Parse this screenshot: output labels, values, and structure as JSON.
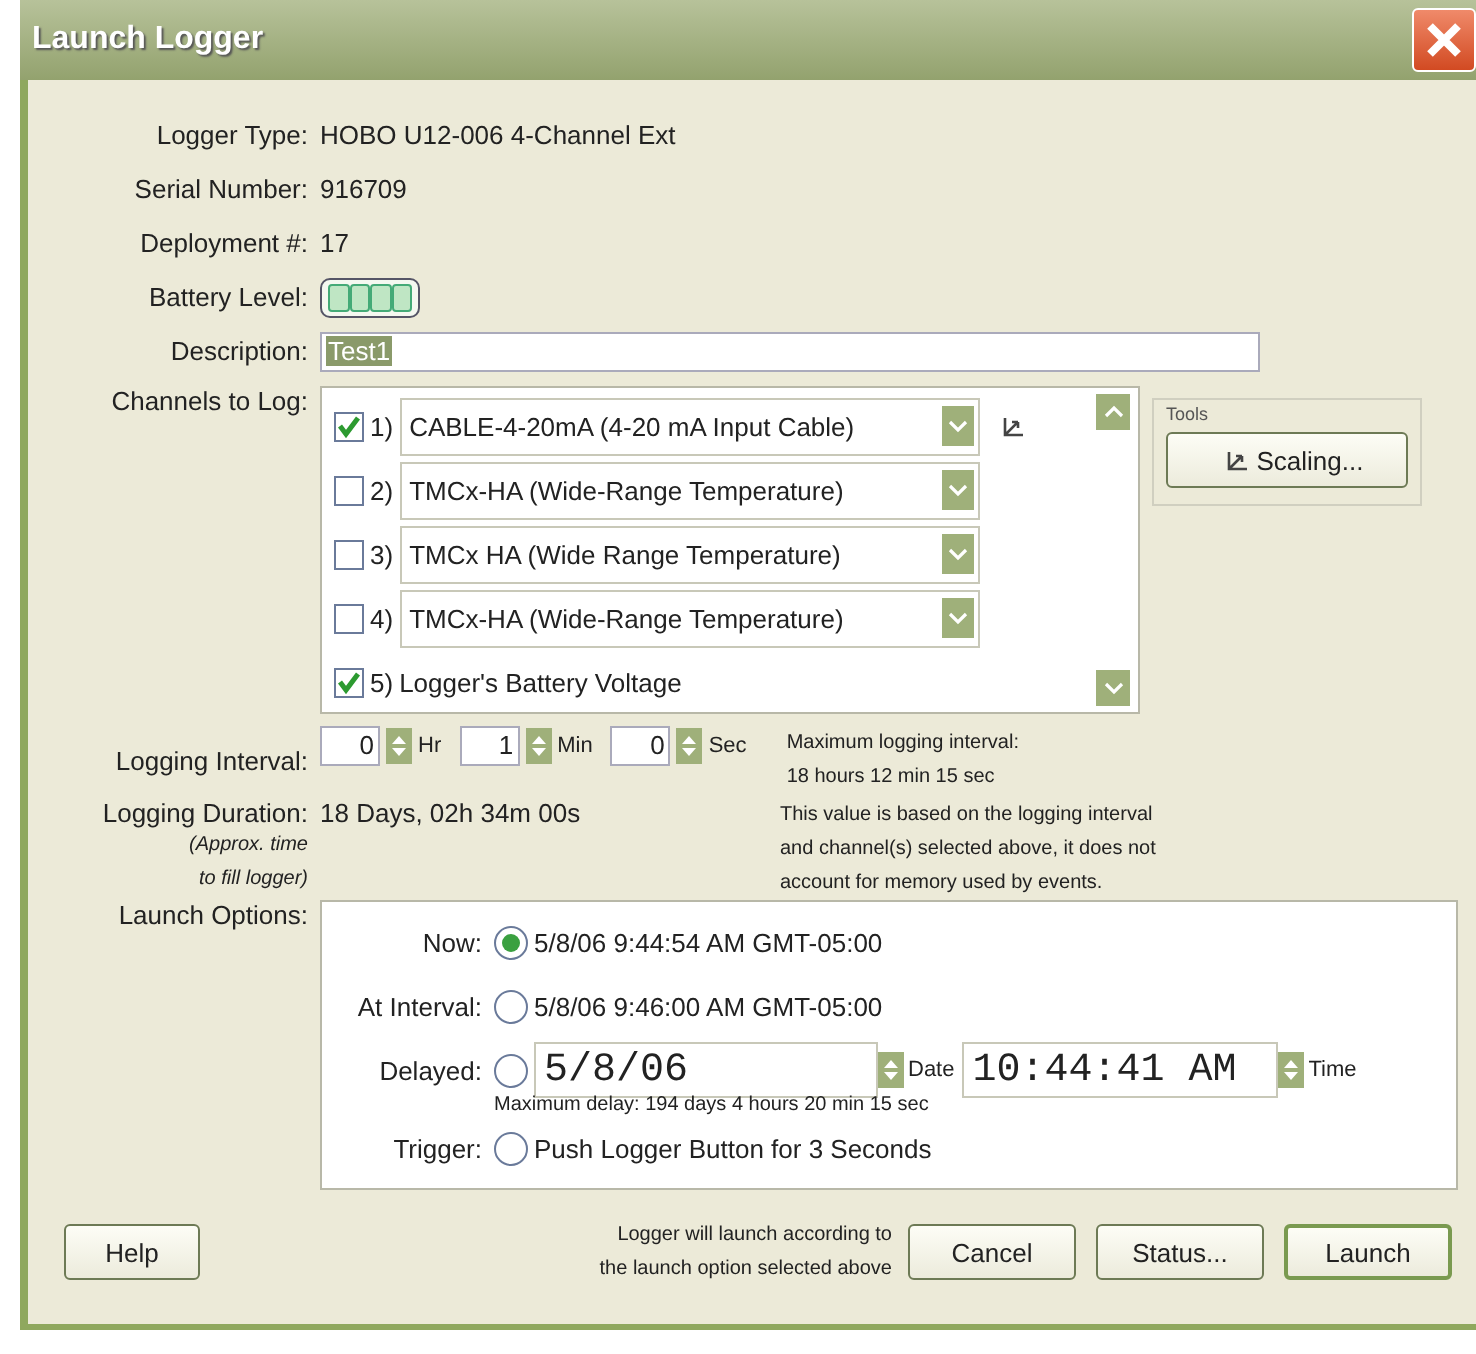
{
  "window": {
    "title": "Launch Logger"
  },
  "info": [
    {
      "label": "Logger Type:",
      "value": "HOBO U12-006 4-Channel Ext"
    },
    {
      "label": "Serial Number:",
      "value": "916709"
    },
    {
      "label": "Deployment #:",
      "value": "17"
    }
  ],
  "battery": {
    "label": "Battery Level:",
    "level": 1
  },
  "description": {
    "label": "Description:",
    "value": "Test1"
  },
  "channels": {
    "label": "Channels to Log:",
    "items": [
      {
        "kind": "dropdown",
        "number": "1)",
        "name": "CABLE-4-20mA (4-20 mA Input Cable)",
        "checked": true,
        "scaling": true
      },
      {
        "kind": "dropdown",
        "number": "2)",
        "name": "TMCx-HA (Wide-Range Temperature)",
        "checked": false,
        "scaling": false
      },
      {
        "kind": "dropdown",
        "number": "3)",
        "name": "TMCx HA (Wide Range Temperature)",
        "checked": false,
        "scaling": false
      },
      {
        "kind": "dropdown",
        "number": "4)",
        "name": "TMCx-HA (Wide-Range Temperature)",
        "checked": false,
        "scaling": false
      },
      {
        "kind": "plain",
        "number": "5)",
        "name": "Logger's Battery Voltage",
        "checked": true,
        "scaling": false
      }
    ]
  },
  "tools": {
    "title": "Tools",
    "button": "Scaling..."
  },
  "logging_interval": {
    "label": "Logging Interval:",
    "fields": [
      {
        "value": "0",
        "unit": "Hr"
      },
      {
        "value": "1",
        "unit": "Min"
      },
      {
        "value": "0",
        "unit": "Sec"
      }
    ],
    "note": [
      "Maximum logging interval:",
      "18 hours 12 min 15 sec"
    ]
  },
  "logging_duration": {
    "label": "Logging Duration:",
    "sublabel": [
      "(Approx. time",
      "to fill logger)"
    ],
    "value": "18 Days, 02h 34m 00s",
    "note": [
      "This value is based on the logging interval",
      "and channel(s) selected above, it does not",
      "account for memory used by events."
    ]
  },
  "launch_options": {
    "label": "Launch Options:",
    "options": [
      {
        "kind": "text",
        "label": "Now:",
        "text": "5/8/06 9:44:54 AM GMT-05:00",
        "selected": true
      },
      {
        "kind": "text",
        "label": "At Interval:",
        "text": "5/8/06 9:46:00 AM GMT-05:00",
        "selected": false
      },
      {
        "kind": "datetime",
        "label": "Delayed:",
        "date": "5/8/06",
        "date_unit": "Date",
        "time": "10:44:41 AM",
        "time_unit": "Time",
        "note": "Maximum delay: 194 days 4 hours 20 min 15 sec",
        "selected": false
      },
      {
        "kind": "text",
        "label": "Trigger:",
        "text": "Push Logger Button for 3 Seconds",
        "selected": false
      }
    ]
  },
  "footer": {
    "help": "Help",
    "note": [
      "Logger will launch according to",
      "the launch option selected above"
    ],
    "buttons": [
      {
        "label": "Cancel",
        "default": false
      },
      {
        "label": "Status...",
        "default": false
      },
      {
        "label": "Launch",
        "default": true
      }
    ]
  }
}
